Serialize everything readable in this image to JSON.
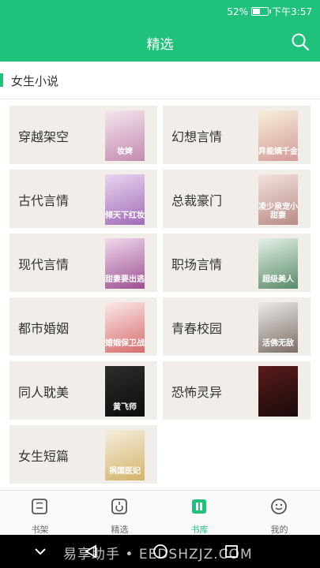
{
  "status_bar": {
    "battery_percent": "52%",
    "battery_level": 0.52,
    "time": "下午3:57"
  },
  "header": {
    "title": "精选",
    "search_icon": "search-icon"
  },
  "section": {
    "title": "女生小说"
  },
  "categories": [
    {
      "label": "穿越架空",
      "cover_title": "妆婢",
      "cover_colors": [
        "#f4e6ee",
        "#c48ab0"
      ]
    },
    {
      "label": "幻想言情",
      "cover_title": "异能嫡千金",
      "cover_colors": [
        "#f6f0d8",
        "#d49a9a"
      ]
    },
    {
      "label": "古代言情",
      "cover_title": "倾天下红妆",
      "cover_colors": [
        "#e9d6f0",
        "#a06bb8"
      ]
    },
    {
      "label": "总裁豪门",
      "cover_title": "凌少泉宠小甜妻",
      "cover_colors": [
        "#f3e3df",
        "#b98b86"
      ]
    },
    {
      "label": "现代言情",
      "cover_title": "甜妻要出逃",
      "cover_colors": [
        "#f0d9ec",
        "#9d4f92"
      ]
    },
    {
      "label": "职场言情",
      "cover_title": "超级美人",
      "cover_colors": [
        "#e4f2e7",
        "#5a8a6a"
      ]
    },
    {
      "label": "都市婚姻",
      "cover_title": "婚姻保卫战",
      "cover_colors": [
        "#fbe9e9",
        "#d66c6c"
      ]
    },
    {
      "label": "青春校园",
      "cover_title": "活佛无敌",
      "cover_colors": [
        "#ecebe8",
        "#7b6e66"
      ]
    },
    {
      "label": "同人耽美",
      "cover_title": "黄飞师",
      "cover_colors": [
        "#2b2e2a",
        "#0c0c0c"
      ]
    },
    {
      "label": "恐怖灵异",
      "cover_title": "",
      "cover_colors": [
        "#5a1b1b",
        "#1a0a0a"
      ]
    },
    {
      "label": "女生短篇",
      "cover_title": "祸国医妃",
      "cover_colors": [
        "#f4eedc",
        "#d4b36a"
      ]
    }
  ],
  "tabbar": {
    "items": [
      {
        "label": "书架",
        "icon": "bookshelf-icon",
        "active": false
      },
      {
        "label": "精选",
        "icon": "featured-icon",
        "active": false
      },
      {
        "label": "书库",
        "icon": "library-icon",
        "active": true
      },
      {
        "label": "我的",
        "icon": "profile-icon",
        "active": false
      }
    ]
  },
  "navbar": {
    "watermark": "易享助手 • EEDSHZJZ.COM"
  },
  "colors": {
    "accent": "#1fc17b",
    "card_bg": "#f1eeea"
  }
}
